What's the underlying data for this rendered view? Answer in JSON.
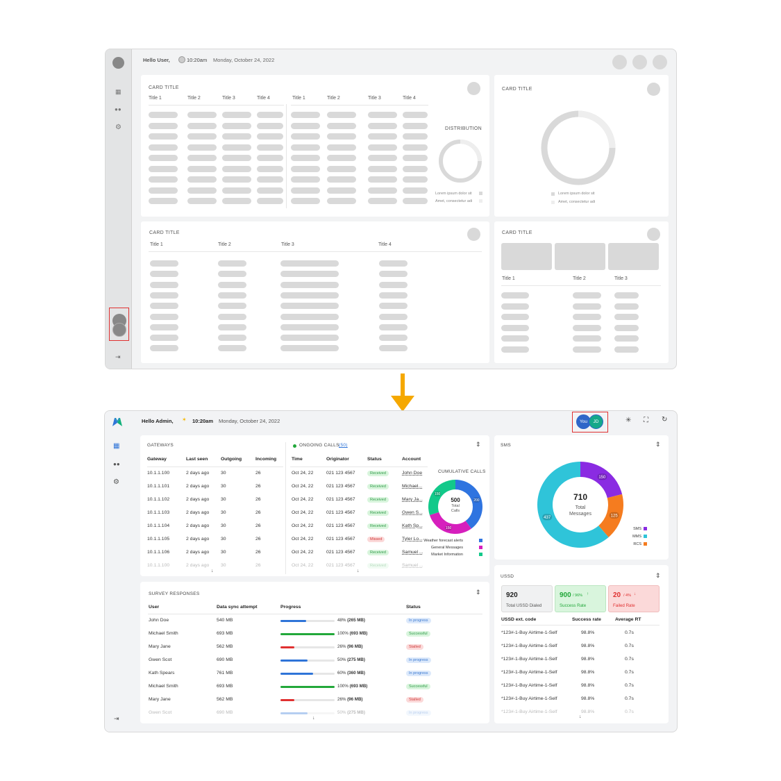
{
  "wireframe": {
    "greeting": "Hello User,",
    "time": "10:20am",
    "date": "Monday, October 24, 2022",
    "card1": {
      "title": "CARD TITLE",
      "cols_left": [
        "Title 1",
        "Title 2",
        "Title 3",
        "Title 4"
      ],
      "cols_right": [
        "Title 1",
        "Title 2",
        "Title 3",
        "Title 4"
      ],
      "dist_title": "DISTRIBUTION",
      "legend": [
        "Lorem ipsum dolor sit",
        "Amet, consectetur adi"
      ]
    },
    "card2": {
      "title": "CARD TITLE",
      "legend": [
        "Lorem ipsum dolor sit",
        "Amet, consectetur adi"
      ]
    },
    "card3": {
      "title": "CARD TITLE",
      "cols": [
        "Title 1",
        "Title 2",
        "Title 3",
        "Title 4"
      ]
    },
    "card4": {
      "title": "CARD TITLE",
      "cols": [
        "Title 1",
        "Title 2",
        "Title 3"
      ]
    }
  },
  "header": {
    "greeting": "Hello Admin,",
    "time": "10:20am",
    "date": "Monday, October 24, 2022",
    "avatar_you": "You",
    "avatar_jd": "JD"
  },
  "icons": {
    "logo": "logo-icon",
    "dashboard": "dashboard-icon",
    "users": "users-icon",
    "settings": "gear-icon",
    "logout": "logout-icon",
    "brightness": "brightness-icon",
    "fullscreen": "fullscreen-icon",
    "refresh": "refresh-icon",
    "weather": "sun-icon"
  },
  "gateways": {
    "title": "GATEWAYS",
    "cols": [
      "Gateway",
      "Last seen",
      "Outgoing",
      "Incoming"
    ],
    "rows": [
      [
        "10.1.1.100",
        "2 days ago",
        "30",
        "26"
      ],
      [
        "10.1.1.101",
        "2 days ago",
        "30",
        "26"
      ],
      [
        "10.1.1.102",
        "2 days ago",
        "30",
        "26"
      ],
      [
        "10.1.1.103",
        "2 days ago",
        "30",
        "26"
      ],
      [
        "10.1.1.104",
        "2 days ago",
        "30",
        "26"
      ],
      [
        "10.1.1.105",
        "2 days ago",
        "30",
        "26"
      ],
      [
        "10.1.1.106",
        "2 days ago",
        "30",
        "26"
      ],
      [
        "10.1.1.100",
        "2 days ago",
        "30",
        "26"
      ]
    ]
  },
  "calls": {
    "title": "ONGOING CALLS",
    "count": "(50)",
    "cols": [
      "Time",
      "Originator",
      "Status",
      "Account"
    ],
    "rows": [
      [
        "Oct 24, 22",
        "021 123 4567",
        "Received",
        "John Doe"
      ],
      [
        "Oct 24, 22",
        "021 123 4567",
        "Received",
        "Michael..."
      ],
      [
        "Oct 24, 22",
        "021 123 4567",
        "Received",
        "Mary Ja..."
      ],
      [
        "Oct 24, 22",
        "021 123 4567",
        "Received",
        "Gwen S..."
      ],
      [
        "Oct 24, 22",
        "021 123 4567",
        "Received",
        "Kath Sp..."
      ],
      [
        "Oct 24, 22",
        "021 123 4567",
        "Missed",
        "Tyler Lo..."
      ],
      [
        "Oct 24, 22",
        "021 123 4567",
        "Received",
        "Samuel ..."
      ],
      [
        "Oct 24, 22",
        "021 123 4567",
        "Received",
        "Samuel ..."
      ]
    ]
  },
  "cumulative": {
    "title": "CUMULATIVE CALLS",
    "total": "500",
    "total_label1": "Total",
    "total_label2": "Calls",
    "legend": [
      "Weather forecast alerts",
      "General Messages",
      "Market Information"
    ]
  },
  "sms": {
    "title": "SMS",
    "total": "710",
    "label1": "Total",
    "label2": "Messages",
    "legend": [
      "SMS",
      "MMS",
      "RCS"
    ]
  },
  "ussd": {
    "title": "USSD",
    "stats": [
      {
        "value": "920",
        "pct": "",
        "label": "Total USSD Dialed"
      },
      {
        "value": "900",
        "pct": "/ 96%",
        "label": "Success Rate"
      },
      {
        "value": "20",
        "pct": "/ 4%",
        "label": "Failed Rate"
      }
    ],
    "cols": [
      "USSD ext. code",
      "Success rate",
      "Average RT"
    ],
    "rows": [
      [
        "*123#-1-Buy Airtime-1-Self",
        "98.8%",
        "0.7s"
      ],
      [
        "*123#-1-Buy Airtime-1-Self",
        "98.8%",
        "0.7s"
      ],
      [
        "*123#-1-Buy Airtime-1-Self",
        "98.8%",
        "0.7s"
      ],
      [
        "*123#-1-Buy Airtime-1-Self",
        "98.8%",
        "0.7s"
      ],
      [
        "*123#-1-Buy Airtime-1-Self",
        "98.8%",
        "0.7s"
      ],
      [
        "*123#-1-Buy Airtime-1-Self",
        "98.8%",
        "0.7s"
      ],
      [
        "*123#-1-Buy Airtime-1-Self",
        "98.8%",
        "0.7s"
      ]
    ]
  },
  "survey": {
    "title": "SURVEY RESPONSES",
    "cols": [
      "User",
      "Data sync attempt",
      "Progress",
      "Status"
    ],
    "rows": [
      {
        "user": "John Doe",
        "data": "540 MB",
        "pct": 48,
        "pct_label": "48%",
        "size": "(265 MB)",
        "status": "In progress"
      },
      {
        "user": "Michael Smith",
        "data": "693 MB",
        "pct": 100,
        "pct_label": "100%",
        "size": "(693 MB)",
        "status": "Successful"
      },
      {
        "user": "Mary Jane",
        "data": "562 MB",
        "pct": 26,
        "pct_label": "26%",
        "size": "(96 MB)",
        "status": "Stalled"
      },
      {
        "user": "Gwen Scot",
        "data": "690 MB",
        "pct": 50,
        "pct_label": "50%",
        "size": "(275 MB)",
        "status": "In progress"
      },
      {
        "user": "Kath Spears",
        "data": "761 MB",
        "pct": 60,
        "pct_label": "60%",
        "size": "(360 MB)",
        "status": "In progress"
      },
      {
        "user": "Michael Smith",
        "data": "693 MB",
        "pct": 100,
        "pct_label": "100%",
        "size": "(693 MB)",
        "status": "Successful"
      },
      {
        "user": "Mary Jane",
        "data": "562 MB",
        "pct": 26,
        "pct_label": "26%",
        "size": "(96 MB)",
        "status": "Stalled"
      },
      {
        "user": "Gwen Scot",
        "data": "690 MB",
        "pct": 50,
        "pct_label": "50%",
        "size": "(275 MB)",
        "status": "In progress"
      }
    ]
  },
  "colors": {
    "success": "#22a83a",
    "failed": "#e03030",
    "progress": "#2f74d8",
    "accent": "#2f74d8"
  },
  "chart_data": [
    {
      "type": "pie",
      "title": "CUMULATIVE CALLS",
      "labels": [
        "Weather forecast alerts",
        "General Messages",
        "Market Information"
      ],
      "values": [
        200,
        150,
        150
      ],
      "colors": [
        "#2f74e0",
        "#d61fbd",
        "#12c98a"
      ]
    },
    {
      "type": "pie",
      "title": "SMS",
      "labels": [
        "SMS",
        "MMS",
        "RCS"
      ],
      "values": [
        150,
        437,
        125
      ],
      "colors": [
        "#8a2be2",
        "#2fc4d9",
        "#f57c1f"
      ]
    }
  ]
}
